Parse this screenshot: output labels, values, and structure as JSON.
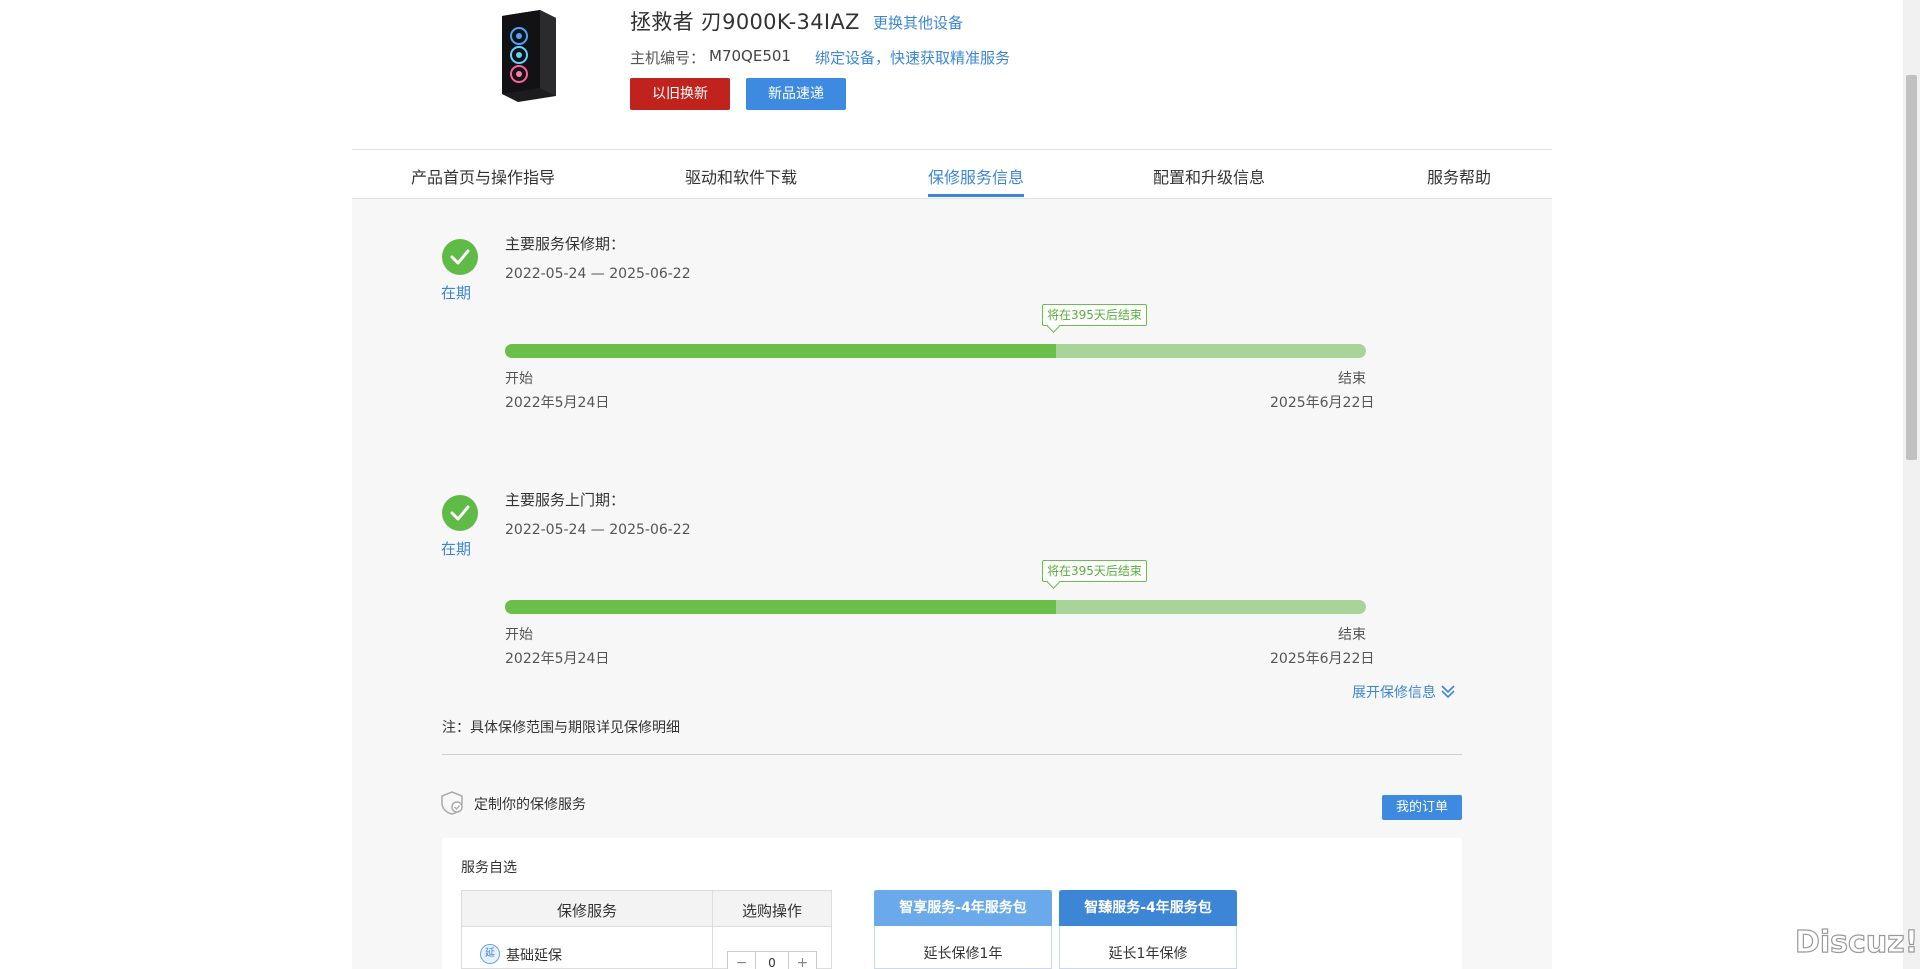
{
  "product": {
    "name": "拯救者 刃9000K-34IAZ",
    "change_device": "更换其他设备",
    "serial_label": "主机编号：",
    "serial_value": "M70QE501",
    "bind_device": "绑定设备，快速获取精准服务",
    "trade_in_button": "以旧换新",
    "new_arrivals_button": "新品速递"
  },
  "tabs": [
    {
      "label": "产品首页与操作指导",
      "active": false
    },
    {
      "label": "驱动和软件下载",
      "active": false
    },
    {
      "label": "保修服务信息",
      "active": true
    },
    {
      "label": "配置和升级信息",
      "active": false
    },
    {
      "label": "服务帮助",
      "active": false
    }
  ],
  "warranties": [
    {
      "status": "在期",
      "title": "主要服务保修期：",
      "range": "2022-05-24 — 2025-06-22",
      "remaining_tag": "将在395天后结束",
      "progress": 0.64,
      "start_label": "开始",
      "start_date": "2022年5月24日",
      "end_label": "结束",
      "end_date": "2025年6月22日"
    },
    {
      "status": "在期",
      "title": "主要服务上门期：",
      "range": "2022-05-24 — 2025-06-22",
      "remaining_tag": "将在395天后结束",
      "progress": 0.64,
      "start_label": "开始",
      "start_date": "2022年5月24日",
      "end_label": "结束",
      "end_date": "2025年6月22日"
    }
  ],
  "expand_link": "展开保修信息",
  "note": "注：具体保修范围与期限详见保修明细",
  "custom_service": {
    "title": "定制你的保修服务",
    "my_orders_button": "我的订单",
    "self_select": "服务自选",
    "table_headers": [
      "保修服务",
      "选购操作"
    ],
    "rows": [
      {
        "icon_text": "延",
        "label": "基础延保",
        "quantity": "0",
        "minus": "−",
        "plus": "+"
      }
    ],
    "packages": [
      {
        "title": "智享服务-4年服务包",
        "desc": "延长保修1年",
        "color": "#6aaaeb"
      },
      {
        "title": "智臻服务-4年服务包",
        "desc": "延长1年保修",
        "color": "#3d86d6"
      }
    ]
  },
  "watermark": "Discuz!",
  "colors": {
    "accent": "#3d86d6",
    "success": "#5fbb46",
    "danger": "#c0231d"
  }
}
